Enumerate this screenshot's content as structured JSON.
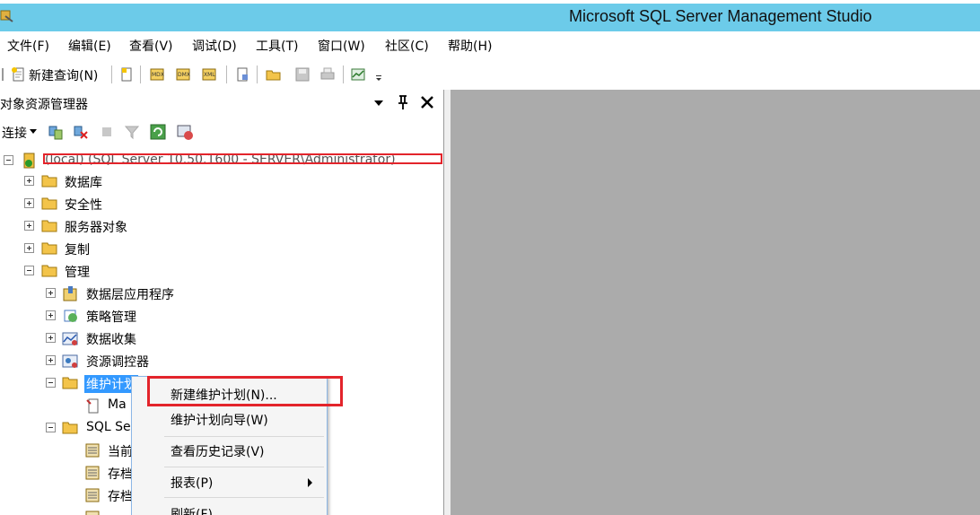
{
  "window": {
    "title": "Microsoft SQL Server Management Studio"
  },
  "menu": [
    {
      "label": "文件(F)"
    },
    {
      "label": "编辑(E)"
    },
    {
      "label": "查看(V)"
    },
    {
      "label": "调试(D)"
    },
    {
      "label": "工具(T)"
    },
    {
      "label": "窗口(W)"
    },
    {
      "label": "社区(C)"
    },
    {
      "label": "帮助(H)"
    }
  ],
  "toolbar": {
    "new_query_label": "新建查询(N)"
  },
  "object_explorer": {
    "title": "对象资源管理器",
    "connect_label": "连接",
    "tree": {
      "server": "(local) (SQL Server 10.50.1600 - SERVER\\Administrator)",
      "items": [
        {
          "label": "数据库"
        },
        {
          "label": "安全性"
        },
        {
          "label": "服务器对象"
        },
        {
          "label": "复制"
        },
        {
          "label": "管理"
        },
        {
          "label": "数据层应用程序"
        },
        {
          "label": "策略管理"
        },
        {
          "label": "数据收集"
        },
        {
          "label": "资源调控器"
        },
        {
          "label": "维护计划"
        },
        {
          "label": "Ma"
        },
        {
          "label": "SQL Se"
        },
        {
          "label": "当前"
        },
        {
          "label": "存档"
        },
        {
          "label": "存档"
        }
      ]
    }
  },
  "context_menu": {
    "items": [
      {
        "label": "新建维护计划(N)..."
      },
      {
        "label": "维护计划向导(W)"
      },
      {
        "label": "查看历史记录(V)"
      },
      {
        "label": "报表(P)"
      },
      {
        "label": "刷新(F)"
      }
    ]
  },
  "colors": {
    "title_bar": "#6ccbe9",
    "highlight_box": "#e3242b",
    "workspace": "#ababab"
  }
}
